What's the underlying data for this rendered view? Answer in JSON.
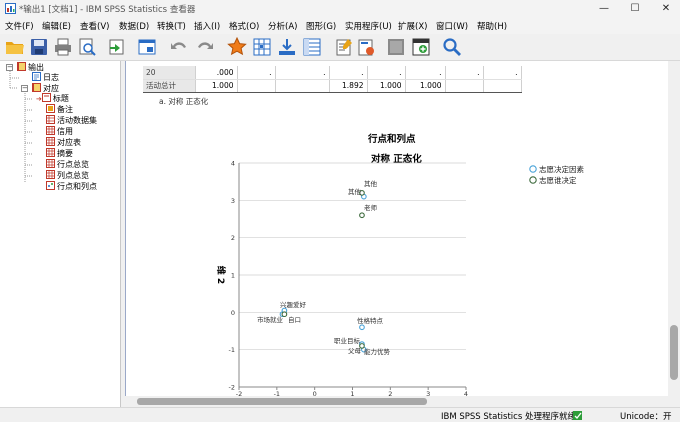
{
  "window": {
    "title": "*输出1 [文档1] - IBM SPSS Statistics 查看器",
    "controls": {
      "minimize": "—",
      "maximize": "☐",
      "close": "✕"
    }
  },
  "menu": [
    "文件(F)",
    "编辑(E)",
    "查看(V)",
    "数据(D)",
    "转换(T)",
    "插入(I)",
    "格式(O)",
    "分析(A)",
    "图形(G)",
    "实用程序(U)",
    "扩展(X)",
    "窗口(W)",
    "帮助(H)"
  ],
  "toolbar_icons": [
    "open-folder-icon",
    "save-icon",
    "print-icon",
    "print-preview-icon",
    "export-icon",
    "recall-dialog-icon",
    "undo-icon",
    "redo-icon",
    "goto-data-icon",
    "goto-case-icon",
    "goto-variable-icon",
    "variables-icon",
    "insert-heading-icon",
    "insert-title-icon",
    "show-all-icon",
    "designate-window-icon",
    "search-icon"
  ],
  "outline": {
    "items": [
      {
        "label": "输出",
        "icon": "output-book-icon"
      },
      {
        "label": "日志",
        "icon": "log-icon"
      },
      {
        "label": "对应",
        "icon": "procedure-book-icon"
      },
      {
        "label": "标题",
        "icon": "title-icon"
      },
      {
        "label": "备注",
        "icon": "notes-icon"
      },
      {
        "label": "活动数据集",
        "icon": "dataset-icon"
      },
      {
        "label": "信用",
        "icon": "table-icon"
      },
      {
        "label": "对应表",
        "icon": "table-icon"
      },
      {
        "label": "摘要",
        "icon": "table-icon"
      },
      {
        "label": "行点总览",
        "icon": "table-icon"
      },
      {
        "label": "列点总览",
        "icon": "table-icon"
      },
      {
        "label": "行点和列点",
        "icon": "chart-icon"
      }
    ]
  },
  "table_fragment": {
    "rows": [
      {
        "label": "20",
        "cells": [
          ".000",
          ".",
          ".",
          ".",
          ".",
          ".",
          ".",
          "."
        ]
      },
      {
        "label": "活动总计",
        "cells": [
          "1.000",
          "",
          "",
          "1.892",
          "1.000",
          "1.000",
          "",
          ""
        ]
      }
    ],
    "footnote": "a. 对称 正态化"
  },
  "chart_title": "行点和列点",
  "chart_data": {
    "type": "scatter",
    "title": "行点和列点",
    "subtitle": "对称 正态化",
    "ylabel": "维 2",
    "xlabel": "",
    "xlim": [
      -2,
      4
    ],
    "ylim": [
      -2,
      4
    ],
    "xticks": [
      "-2",
      "-1",
      "0",
      "1",
      "2",
      "3",
      "4"
    ],
    "yticks": [
      "4",
      "3",
      "2",
      "1",
      "0",
      "-1",
      "-2"
    ],
    "grid": "horizontal",
    "legend_position": "right",
    "series": [
      {
        "name": "志愿决定因素",
        "color": "#4aa3d8",
        "points": [
          {
            "label": "其他",
            "x": 1.3,
            "y": 3.1
          },
          {
            "label": "性格特点",
            "x": 1.25,
            "y": -0.4
          },
          {
            "label": "职业目标",
            "x": 1.25,
            "y": -0.85
          },
          {
            "label": "能力优势",
            "x": 1.3,
            "y": -1.0
          },
          {
            "label": "兴趣爱好",
            "x": -0.8,
            "y": 0.05
          },
          {
            "label": "就业",
            "x": -0.85,
            "y": -0.05
          }
        ]
      },
      {
        "name": "志愿谁决定",
        "color": "#3e6b3e",
        "points": [
          {
            "label": "其他",
            "x": 1.25,
            "y": 3.2
          },
          {
            "label": "老师",
            "x": 1.25,
            "y": 2.6
          },
          {
            "label": "自己",
            "x": -0.8,
            "y": -0.05
          },
          {
            "label": "父母",
            "x": 1.25,
            "y": -0.9
          }
        ]
      }
    ]
  },
  "chart_text": {
    "y_axis_label": "维 2",
    "subtitle": "对称 正态化",
    "point_labels": {
      "qita_top": "其他",
      "qita_left": "其他",
      "laoshi": "老师",
      "xingqu": "兴趣爱好",
      "shichang": "市场就业",
      "ziji": "自口",
      "xingge": "性格特点",
      "zhiye": "职业目标",
      "fumu": "父母",
      "nengli": "能力优势"
    }
  },
  "status": {
    "processor": "IBM SPSS Statistics 处理程序就绪",
    "unicode": "Unicode：开"
  }
}
